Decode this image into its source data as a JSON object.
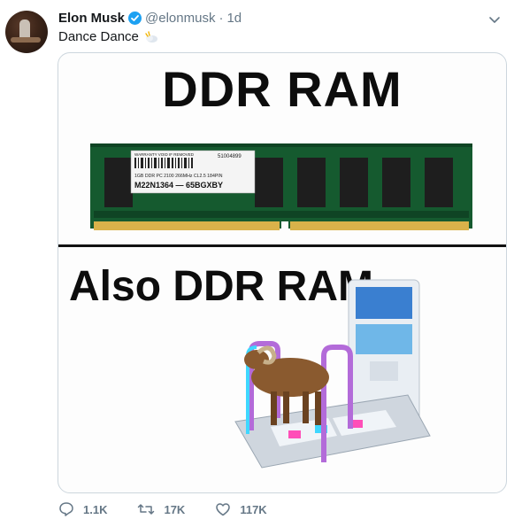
{
  "tweet": {
    "author_name": "Elon Musk",
    "handle": "@elonmusk",
    "separator": "·",
    "time": "1d",
    "text": "Dance Dance",
    "emoji": "dancing-cloud-emoji"
  },
  "media": {
    "top_caption": "DDR RAM",
    "bottom_caption": "Also DDR RAM",
    "ram_label_line1": "WARRANTY VOID IF REMOVED",
    "ram_label_number": "51004899",
    "ram_label_line2": "1GB DDR PC 2100 266MHz CL2.5 184PIN",
    "ram_label_line3": "M22N1364 — 65BGXBY"
  },
  "actions": {
    "reply_count": "1.1K",
    "retweet_count": "17K",
    "like_count": "117K"
  },
  "colors": {
    "verified": "#1da1f2",
    "meta": "#657786"
  }
}
